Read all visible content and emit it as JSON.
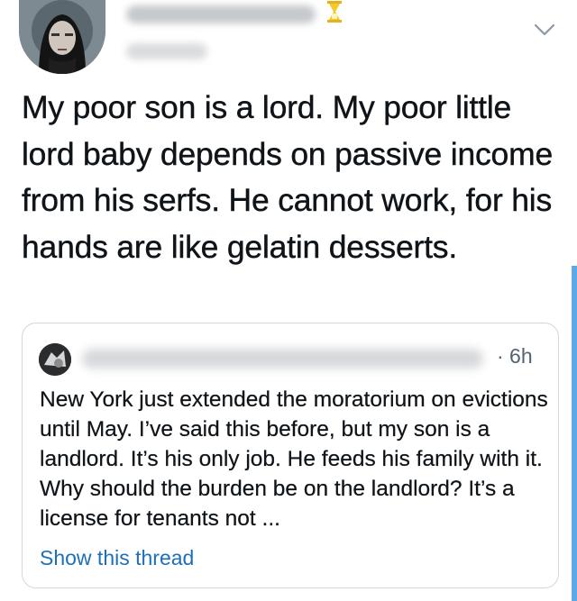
{
  "tweet": {
    "text": "My poor son is a lord. My poor little lord baby depends on passive income from his serfs. He cannot work, for his hands are like gelatin desserts.",
    "avatar_icon": "avatar-icon",
    "badge_icon": "hourglass-icon",
    "menu_icon": "chevron-down-icon"
  },
  "quote": {
    "time": "· 6h",
    "text": "New York just extended the moratorium on evictions until May. I’ve said this before, but my son is a landlord. It’s his only job. He feeds his family with it. Why should the burden be on the landlord? It’s a license for tenants not ...",
    "show_thread": "Show this thread"
  },
  "colors": {
    "text": "#0f1419",
    "secondary": "#536471",
    "link": "#1d70b8",
    "border": "#cfd9de",
    "accent": "#5fa8e8"
  }
}
